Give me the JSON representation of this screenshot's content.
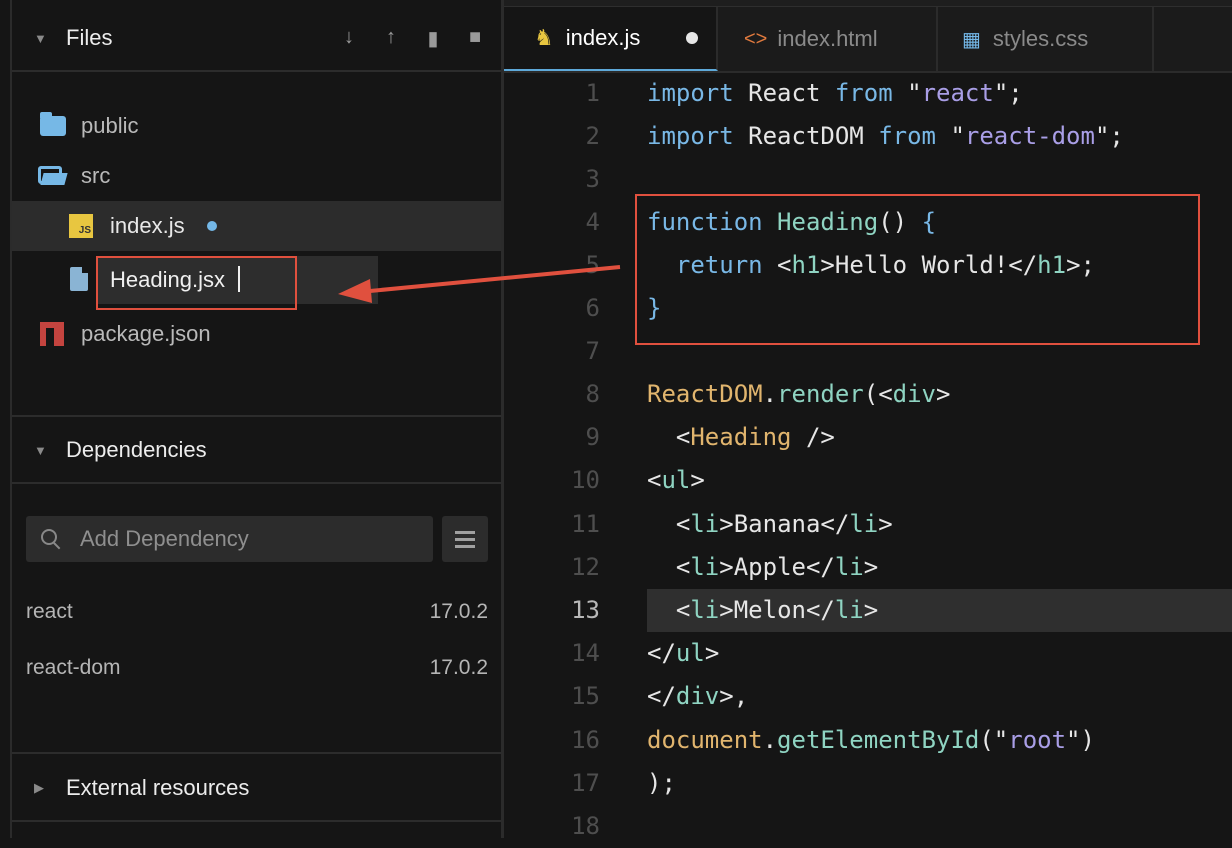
{
  "sidebar": {
    "files_title": "Files",
    "tree": [
      {
        "label": "public",
        "icon": "folder-icon"
      },
      {
        "label": "src",
        "icon": "folder-open-icon"
      },
      {
        "label": "index.js",
        "icon": "js-file-icon",
        "modified": true
      },
      {
        "label": "package.json",
        "icon": "npm-icon"
      }
    ],
    "rename_value": "Heading.jsx",
    "dependencies_title": "Dependencies",
    "add_dependency_placeholder": "Add Dependency",
    "dependencies": [
      {
        "name": "react",
        "version": "17.0.2"
      },
      {
        "name": "react-dom",
        "version": "17.0.2"
      }
    ],
    "external_title": "External resources"
  },
  "tabs": [
    {
      "label": "index.js",
      "icon": "js-file-icon",
      "active": true
    },
    {
      "label": "index.html",
      "icon": "html-icon"
    },
    {
      "label": "styles.css",
      "icon": "css-icon"
    }
  ],
  "editor": {
    "current_line": 13,
    "lines": [
      {
        "n": "1",
        "tokens": [
          [
            "kw",
            "import"
          ],
          [
            "punc",
            " React "
          ],
          [
            "kw",
            "from"
          ],
          [
            "punc",
            " \""
          ],
          [
            "str",
            "react"
          ],
          [
            "punc",
            "\";"
          ]
        ]
      },
      {
        "n": "2",
        "tokens": [
          [
            "kw",
            "import"
          ],
          [
            "punc",
            " ReactDOM "
          ],
          [
            "kw",
            "from"
          ],
          [
            "punc",
            " \""
          ],
          [
            "str",
            "react-dom"
          ],
          [
            "punc",
            "\";"
          ]
        ]
      },
      {
        "n": "3",
        "tokens": []
      },
      {
        "n": "4",
        "tokens": [
          [
            "kw",
            "function"
          ],
          [
            "punc",
            " "
          ],
          [
            "fn",
            "Heading"
          ],
          [
            "punc",
            "() "
          ],
          [
            "kw",
            "{"
          ]
        ]
      },
      {
        "n": "5",
        "tokens": [
          [
            "punc",
            "  "
          ],
          [
            "kw",
            "return"
          ],
          [
            "punc",
            " <"
          ],
          [
            "tag",
            "h1"
          ],
          [
            "punc",
            ">Hello World!</"
          ],
          [
            "tag",
            "h1"
          ],
          [
            "punc",
            ">;"
          ]
        ]
      },
      {
        "n": "6",
        "tokens": [
          [
            "kw",
            "}"
          ]
        ]
      },
      {
        "n": "7",
        "tokens": []
      },
      {
        "n": "8",
        "tokens": [
          [
            "id",
            "ReactDOM"
          ],
          [
            "punc",
            "."
          ],
          [
            "fn",
            "render"
          ],
          [
            "punc",
            "(<"
          ],
          [
            "tag",
            "div"
          ],
          [
            "punc",
            ">"
          ]
        ]
      },
      {
        "n": "9",
        "tokens": [
          [
            "punc",
            "  <"
          ],
          [
            "comp",
            "Heading"
          ],
          [
            "punc",
            " />"
          ]
        ]
      },
      {
        "n": "10",
        "tokens": [
          [
            "punc",
            "<"
          ],
          [
            "tag",
            "ul"
          ],
          [
            "punc",
            ">"
          ]
        ]
      },
      {
        "n": "11",
        "tokens": [
          [
            "punc",
            "  <"
          ],
          [
            "tag",
            "li"
          ],
          [
            "punc",
            ">Banana</"
          ],
          [
            "tag",
            "li"
          ],
          [
            "punc",
            ">"
          ]
        ]
      },
      {
        "n": "12",
        "tokens": [
          [
            "punc",
            "  <"
          ],
          [
            "tag",
            "li"
          ],
          [
            "punc",
            ">Apple</"
          ],
          [
            "tag",
            "li"
          ],
          [
            "punc",
            ">"
          ]
        ]
      },
      {
        "n": "13",
        "tokens": [
          [
            "punc",
            "  <"
          ],
          [
            "tag",
            "li"
          ],
          [
            "punc",
            ">Melon</"
          ],
          [
            "tag",
            "li"
          ],
          [
            "punc",
            ">"
          ]
        ]
      },
      {
        "n": "14",
        "tokens": [
          [
            "punc",
            "</"
          ],
          [
            "tag",
            "ul"
          ],
          [
            "punc",
            ">"
          ]
        ]
      },
      {
        "n": "15",
        "tokens": [
          [
            "punc",
            "</"
          ],
          [
            "tag",
            "div"
          ],
          [
            "punc",
            ">,"
          ]
        ]
      },
      {
        "n": "16",
        "tokens": [
          [
            "id",
            "document"
          ],
          [
            "punc",
            "."
          ],
          [
            "fn",
            "getElementById"
          ],
          [
            "punc",
            "(\""
          ],
          [
            "str",
            "root"
          ],
          [
            "punc",
            "\")"
          ]
        ]
      },
      {
        "n": "17",
        "tokens": [
          [
            "punc",
            ");"
          ]
        ]
      },
      {
        "n": "18",
        "tokens": []
      }
    ]
  }
}
